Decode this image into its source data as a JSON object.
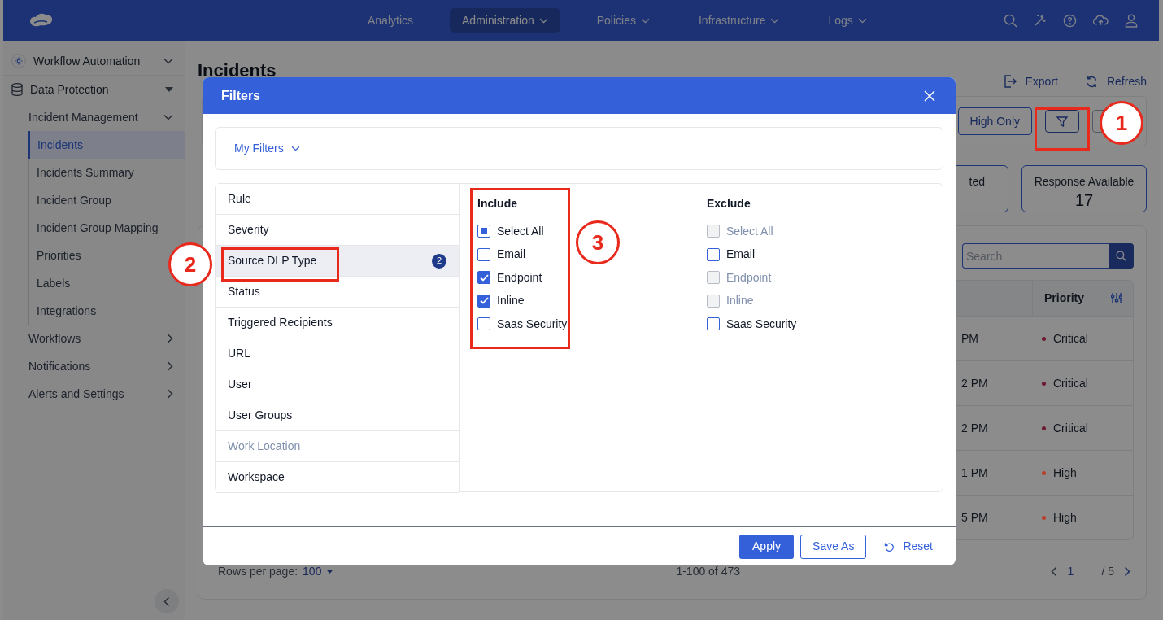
{
  "nav": {
    "items": [
      {
        "label": "Analytics",
        "selected": false,
        "dropdown": false
      },
      {
        "label": "Administration",
        "selected": true,
        "dropdown": true
      },
      {
        "label": "Policies",
        "selected": false,
        "dropdown": true
      },
      {
        "label": "Infrastructure",
        "selected": false,
        "dropdown": true
      },
      {
        "label": "Logs",
        "selected": false,
        "dropdown": true
      }
    ]
  },
  "sidebar": {
    "items": [
      {
        "label": "Workflow Automation",
        "kind": "section",
        "expanded": false
      },
      {
        "label": "Data Protection",
        "kind": "section",
        "expanded": true,
        "children": [
          {
            "label": "Incident Management",
            "kind": "group",
            "expanded": true,
            "children": [
              {
                "label": "Incidents",
                "kind": "link",
                "selected": true
              },
              {
                "label": "Incidents Summary",
                "kind": "link",
                "selected": false
              },
              {
                "label": "Incident Group",
                "kind": "link",
                "selected": false
              },
              {
                "label": "Incident Group Mapping",
                "kind": "link",
                "selected": false
              },
              {
                "label": "Priorities",
                "kind": "link",
                "selected": false
              },
              {
                "label": "Labels",
                "kind": "link",
                "selected": false
              },
              {
                "label": "Integrations",
                "kind": "link",
                "selected": false
              }
            ]
          },
          {
            "label": "Workflows",
            "kind": "group",
            "expanded": false
          },
          {
            "label": "Notifications",
            "kind": "group",
            "expanded": false
          },
          {
            "label": "Alerts and Settings",
            "kind": "group",
            "expanded": false
          }
        ]
      }
    ]
  },
  "page": {
    "title": "Incidents",
    "actions": [
      "Export",
      "Refresh"
    ],
    "toolbar": {
      "high_only": "High Only"
    },
    "stat_cards": [
      {
        "label": "ted"
      },
      {
        "label": "Response Available",
        "value": "17"
      }
    ],
    "table": {
      "search": {
        "placeholder": "Search"
      },
      "columns": [
        "Priority"
      ],
      "rows": [
        {
          "column_1": "PM",
          "priority": "Critical",
          "color": "#6e1a30"
        },
        {
          "column_1": "2 PM",
          "priority": "Critical",
          "color": "#6e1a30"
        },
        {
          "column_1": "2 PM",
          "priority": "Critical",
          "color": "#6e1a30"
        },
        {
          "column_1": "1 PM",
          "priority": "High",
          "color": "#b8402a"
        },
        {
          "column_1": "5 PM",
          "priority": "High",
          "color": "#b8402a"
        }
      ]
    },
    "footer": {
      "rows_per_page_label": "Rows per page:",
      "rows_per_page": "100",
      "range": "1-100 of 473",
      "page": "1",
      "total": "/ 5"
    }
  },
  "modal": {
    "title": "Filters",
    "my_filters": "My Filters",
    "categories": [
      {
        "label": "Rule",
        "selected": false,
        "disabled": false
      },
      {
        "label": "Severity",
        "selected": false,
        "disabled": false
      },
      {
        "label": "Source DLP Type",
        "selected": true,
        "disabled": false,
        "badge": "2"
      },
      {
        "label": "Status",
        "selected": false,
        "disabled": false
      },
      {
        "label": "Triggered Recipients",
        "selected": false,
        "disabled": false
      },
      {
        "label": "URL",
        "selected": false,
        "disabled": false
      },
      {
        "label": "User",
        "selected": false,
        "disabled": false
      },
      {
        "label": "User Groups",
        "selected": false,
        "disabled": false
      },
      {
        "label": "Work Location",
        "selected": false,
        "disabled": true
      },
      {
        "label": "Workspace",
        "selected": false,
        "disabled": false
      }
    ],
    "include": {
      "title": "Include",
      "options": [
        {
          "label": "Select All",
          "checked": false,
          "indeterminate": true,
          "disabled": false
        },
        {
          "label": "Email",
          "checked": false,
          "indeterminate": false,
          "disabled": false
        },
        {
          "label": "Endpoint",
          "checked": true,
          "indeterminate": false,
          "disabled": false
        },
        {
          "label": "Inline",
          "checked": true,
          "indeterminate": false,
          "disabled": false
        },
        {
          "label": "Saas Security",
          "checked": false,
          "indeterminate": false,
          "disabled": false
        }
      ]
    },
    "exclude": {
      "title": "Exclude",
      "options": [
        {
          "label": "Select All",
          "checked": false,
          "indeterminate": false,
          "disabled": true
        },
        {
          "label": "Email",
          "checked": false,
          "indeterminate": false,
          "disabled": false
        },
        {
          "label": "Endpoint",
          "checked": false,
          "indeterminate": false,
          "disabled": true
        },
        {
          "label": "Inline",
          "checked": false,
          "indeterminate": false,
          "disabled": true
        },
        {
          "label": "Saas Security",
          "checked": false,
          "indeterminate": false,
          "disabled": false
        }
      ]
    },
    "buttons": [
      {
        "label": "Apply",
        "kind": "primary"
      },
      {
        "label": "Save As",
        "kind": "outline"
      },
      {
        "label": "Reset",
        "kind": "link"
      }
    ]
  },
  "annotations": [
    {
      "label": "1"
    },
    {
      "label": "2"
    },
    {
      "label": "3"
    }
  ]
}
